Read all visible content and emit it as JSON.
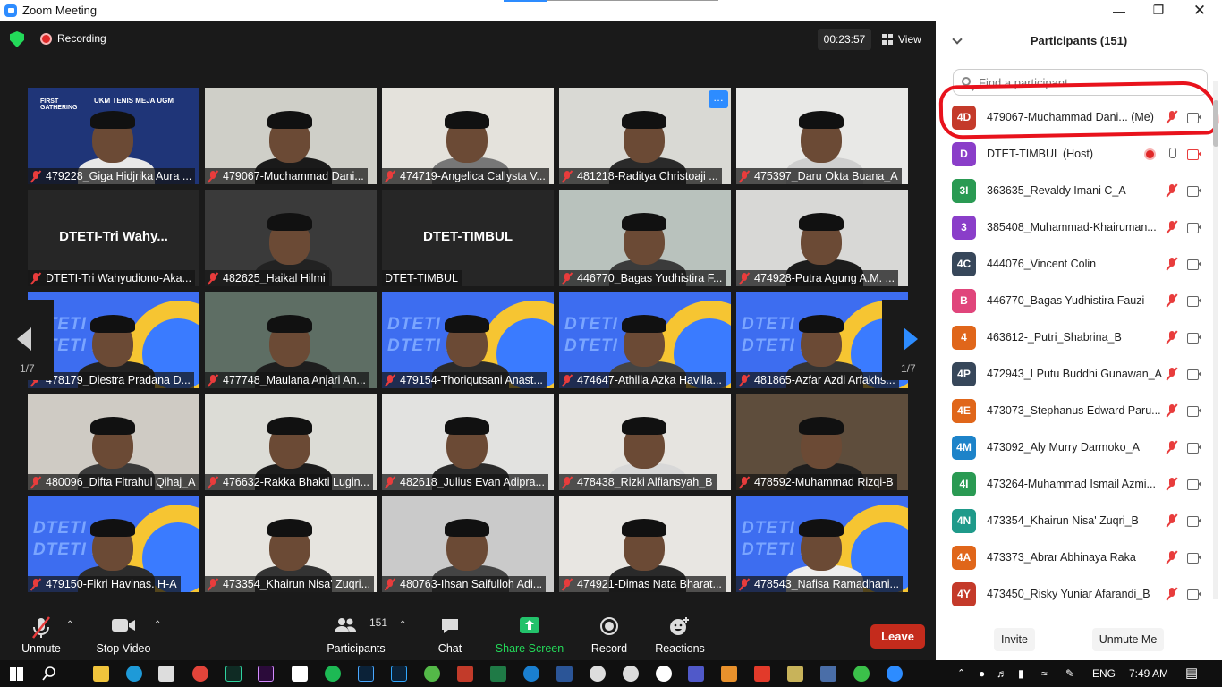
{
  "window": {
    "title": "Zoom Meeting"
  },
  "topbar": {
    "recording": "Recording",
    "timer": "00:23:57",
    "view": "View"
  },
  "tiles": [
    {
      "name": "479228_Giga Hidjrika Aura ...",
      "muted": true,
      "bg": "#1f3578",
      "body": "#e8e8e8",
      "banner": "UKM TENIS MEJA UGM",
      "banner2": "FIRST GATHERING"
    },
    {
      "name": "479067-Muchammad Dani...",
      "muted": true,
      "bg": "#cfcfc8",
      "body": "#1a1a1a"
    },
    {
      "name": "474719-Angelica Callysta V...",
      "muted": true,
      "bg": "#e4e2dc",
      "body": "#777"
    },
    {
      "name": "481218-Raditya Christoaji ...",
      "muted": true,
      "bg": "#d9d9d4",
      "body": "#2a2a2a",
      "more": "…"
    },
    {
      "name": "475397_Daru Okta Buana_A",
      "muted": true,
      "bg": "#e8e8e6",
      "body": "#cfcfcf"
    },
    {
      "name": "DTETI-Tri Wahyudiono-Aka...",
      "muted": true,
      "bg": "#262626",
      "label": "DTETI-Tri  Wahy...",
      "active": true
    },
    {
      "name": "482625_Haikal Hilmi",
      "muted": true,
      "bg": "#3a3a3a",
      "body": "#222"
    },
    {
      "name": "DTET-TIMBUL",
      "muted": false,
      "bg": "#262626",
      "label": "DTET-TIMBUL"
    },
    {
      "name": "446770_Bagas Yudhistira F...",
      "muted": true,
      "bg": "#b9c2bd",
      "body": "#3b3b3b"
    },
    {
      "name": "474928-Putra Agung A.M. ...",
      "muted": true,
      "bg": "#d8d8d6",
      "body": "#1c1c1c"
    },
    {
      "name": "478179_Diestra Pradana D...",
      "muted": true,
      "bg": "#3d6df0",
      "body": "#222",
      "dteti": true
    },
    {
      "name": "477748_Maulana Anjari An...",
      "muted": true,
      "bg": "#5e6e64",
      "body": "#1e1e1e"
    },
    {
      "name": "479154-Thoriqutsani Anast...",
      "muted": true,
      "bg": "#3d6df0",
      "body": "#2a2a2a",
      "dteti": true
    },
    {
      "name": "474647-Athilla Azka Havilla...",
      "muted": true,
      "bg": "#3d6df0",
      "body": "#444",
      "dteti": true
    },
    {
      "name": "481865-Azfar Azdi Arfakhs...",
      "muted": true,
      "bg": "#3d6df0",
      "body": "#333",
      "dteti": true
    },
    {
      "name": "480096_Difta Fitrahul Qihaj_A",
      "muted": true,
      "bg": "#cfcbc4",
      "body": "#3a3a3a"
    },
    {
      "name": "476632-Rakka Bhakti Lugin...",
      "muted": true,
      "bg": "#dcdcd6",
      "body": "#1c1c1c"
    },
    {
      "name": "482618_Julius Evan Adipra...",
      "muted": true,
      "bg": "#e2e2e0",
      "body": "#2a2a2a"
    },
    {
      "name": "478438_Rizki Alfiansyah_B",
      "muted": true,
      "bg": "#e6e4e0",
      "body": "#d8d8d8"
    },
    {
      "name": "478592-Muhammad Rizqi-B",
      "muted": true,
      "bg": "#5e4d3c",
      "body": "#1e1e1e"
    },
    {
      "name": "479150-Fikri Havinas. H-A",
      "muted": true,
      "bg": "#3d6df0",
      "body": "#2c2c2c",
      "dteti": true
    },
    {
      "name": "473354_Khairun Nisa' Zuqri...",
      "muted": true,
      "bg": "#e6e4df",
      "body": "#333"
    },
    {
      "name": "480763-Ihsan Saifulloh Adi...",
      "muted": true,
      "bg": "#cacaca",
      "body": "#444"
    },
    {
      "name": "474921-Dimas Nata Bharat...",
      "muted": true,
      "bg": "#e8e6e2",
      "body": "#2a2a2a"
    },
    {
      "name": "478543_Nafisa Ramadhani...",
      "muted": true,
      "bg": "#3d6df0",
      "body": "#eee",
      "dteti": true
    }
  ],
  "pager": {
    "left": "1/7",
    "right": "1/7"
  },
  "toolbar": {
    "unmute": "Unmute",
    "stop_video": "Stop Video",
    "participants": "Participants",
    "participants_count": "151",
    "chat": "Chat",
    "share": "Share Screen",
    "record": "Record",
    "reactions": "Reactions",
    "leave": "Leave"
  },
  "panel": {
    "title": "Participants (151)",
    "search_placeholder": "Find a participant",
    "participants": [
      {
        "avatar": "4D",
        "color": "#c43a2a",
        "name": "479067-Muchammad Dani...  (Me)",
        "mic": "off",
        "cam": "on"
      },
      {
        "avatar": "D",
        "color": "#8a3ec9",
        "name": "DTET-TIMBUL (Host)",
        "mic": "on",
        "cam": "off",
        "rec": true
      },
      {
        "avatar": "3I",
        "color": "#2a9a53",
        "name": "363635_Revaldy Imani C_A",
        "mic": "off",
        "cam": "on"
      },
      {
        "avatar": "3",
        "color": "#8a3ec9",
        "name": "385408_Muhammad-Khairuman...",
        "mic": "off",
        "cam": "on"
      },
      {
        "avatar": "4C",
        "color": "#37475a",
        "name": "444076_Vincent Colin",
        "mic": "off",
        "cam": "on"
      },
      {
        "avatar": "B",
        "color": "#e0457b",
        "name": "446770_Bagas Yudhistira Fauzi",
        "mic": "off",
        "cam": "on"
      },
      {
        "avatar": "4",
        "color": "#e0661a",
        "name": "463612-_Putri_Shabrina_B",
        "mic": "off",
        "cam": "on"
      },
      {
        "avatar": "4P",
        "color": "#37475a",
        "name": "472943_I Putu Buddhi Gunawan_A",
        "mic": "off",
        "cam": "on"
      },
      {
        "avatar": "4E",
        "color": "#e0661a",
        "name": "473073_Stephanus Edward Paru...",
        "mic": "off",
        "cam": "on"
      },
      {
        "avatar": "4M",
        "color": "#1d83c9",
        "name": "473092_Aly Murry Darmoko_A",
        "mic": "off",
        "cam": "on"
      },
      {
        "avatar": "4I",
        "color": "#2a9a53",
        "name": "473264-Muhammad Ismail Azmi...",
        "mic": "off",
        "cam": "on"
      },
      {
        "avatar": "4N",
        "color": "#1f9a8a",
        "name": "473354_Khairun Nisa' Zuqri_B",
        "mic": "off",
        "cam": "on"
      },
      {
        "avatar": "4A",
        "color": "#e0661a",
        "name": "473373_Abrar Abhinaya Raka",
        "mic": "off",
        "cam": "on"
      },
      {
        "avatar": "4Y",
        "color": "#c43a2a",
        "name": "473450_Risky Yuniar Afarandi_B",
        "mic": "off",
        "cam": "on"
      }
    ],
    "invite": "Invite",
    "unmute_me": "Unmute Me"
  },
  "taskbar": {
    "lang": "ENG",
    "time": "7:49 AM"
  },
  "banner": {
    "dteti": "DTETI 21"
  }
}
